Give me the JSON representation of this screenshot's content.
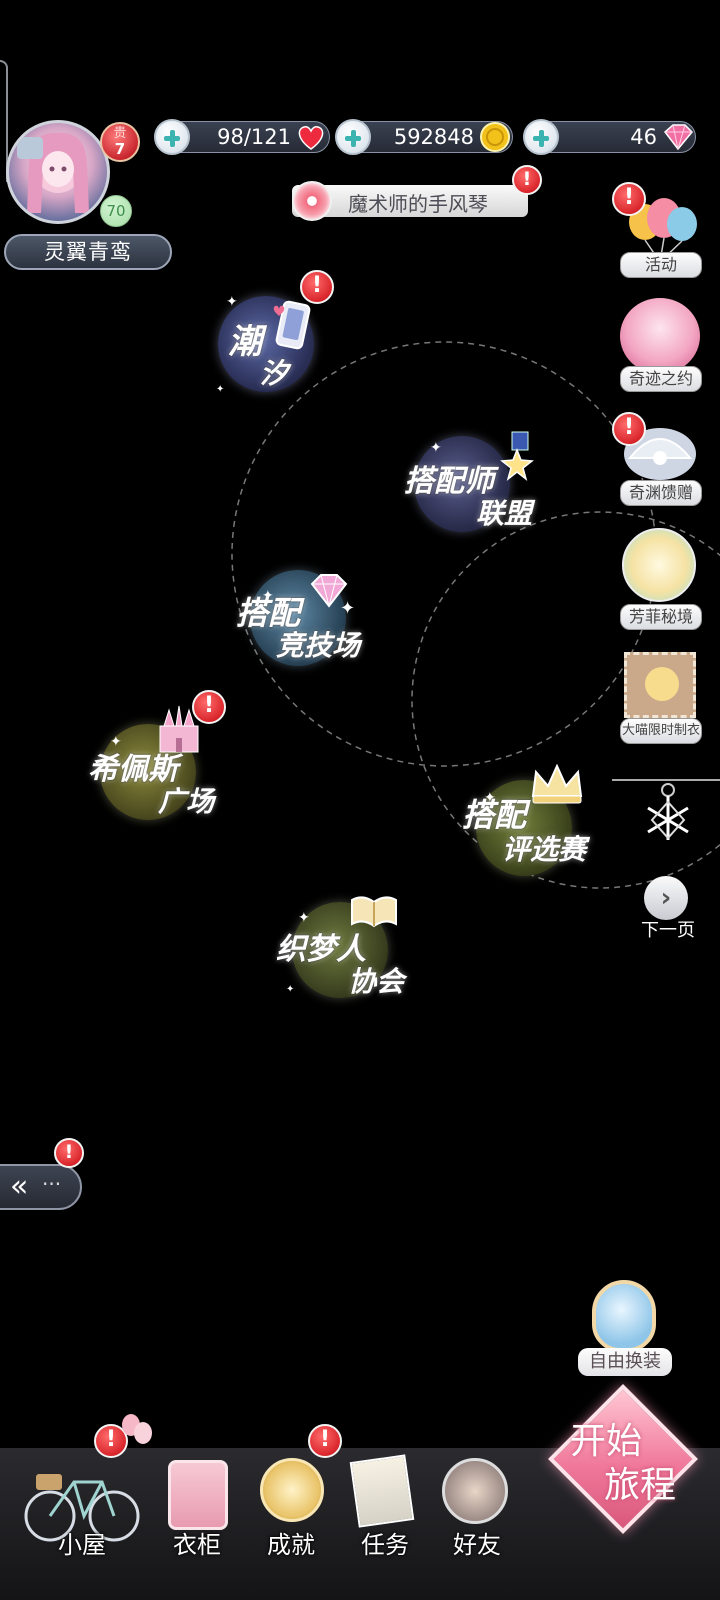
{
  "player": {
    "name": "灵翼青鸾",
    "level": "70",
    "vip_badge_top": "贵",
    "vip_badge_num": "7"
  },
  "currencies": [
    {
      "value": "98/121",
      "icon": "heart-icon"
    },
    {
      "value": "592848",
      "icon": "gold-coin-icon"
    },
    {
      "value": "46",
      "icon": "diamond-icon"
    }
  ],
  "music": {
    "title": "魔术师的手风琴",
    "icon": "record-icon"
  },
  "map_nodes": {
    "chaoxi": {
      "line1": "潮",
      "line2": "汐",
      "icon": "phone-icon"
    },
    "stylist_league": {
      "line1": "搭配师",
      "line2": "联盟",
      "icon": "badge-icon"
    },
    "arena": {
      "line1": "搭配",
      "line2": "竞技场",
      "icon": "diamond-icon"
    },
    "hippeas": {
      "line1": "希佩斯",
      "line2": "广场",
      "icon": "castle-icon"
    },
    "contest": {
      "line1": "搭配",
      "line2": "评选赛",
      "icon": "crown-icon"
    },
    "dreamweaver": {
      "line1": "织梦人",
      "line2": "协会",
      "icon": "book-icon"
    }
  },
  "side_menu": [
    {
      "label": "活动",
      "icon": "balloons-icon",
      "alert": true
    },
    {
      "label": "奇迹之约",
      "icon": "girl-cat-icon",
      "alert": false
    },
    {
      "label": "奇渊馈赠",
      "icon": "shell-icon",
      "alert": true
    },
    {
      "label": "芳菲秘境",
      "icon": "butterfly-icon",
      "alert": false
    },
    {
      "label": "大喵限时制衣",
      "icon": "cat-stamp-icon",
      "alert": false
    }
  ],
  "next_page": {
    "label": "下一页"
  },
  "free_dress": {
    "label": "自由换装"
  },
  "alert_mark": "!",
  "bottom_nav": [
    {
      "label": "小屋",
      "icon": "bicycle-icon",
      "alert": true
    },
    {
      "label": "衣柜",
      "icon": "wardrobe-icon",
      "alert": false
    },
    {
      "label": "成就",
      "icon": "achievement-medal-icon",
      "alert": true
    },
    {
      "label": "任务",
      "icon": "task-icon",
      "alert": false
    },
    {
      "label": "好友",
      "icon": "friends-icon",
      "alert": false
    }
  ],
  "start_journey": {
    "line1": "开始",
    "line2": "旅程"
  }
}
